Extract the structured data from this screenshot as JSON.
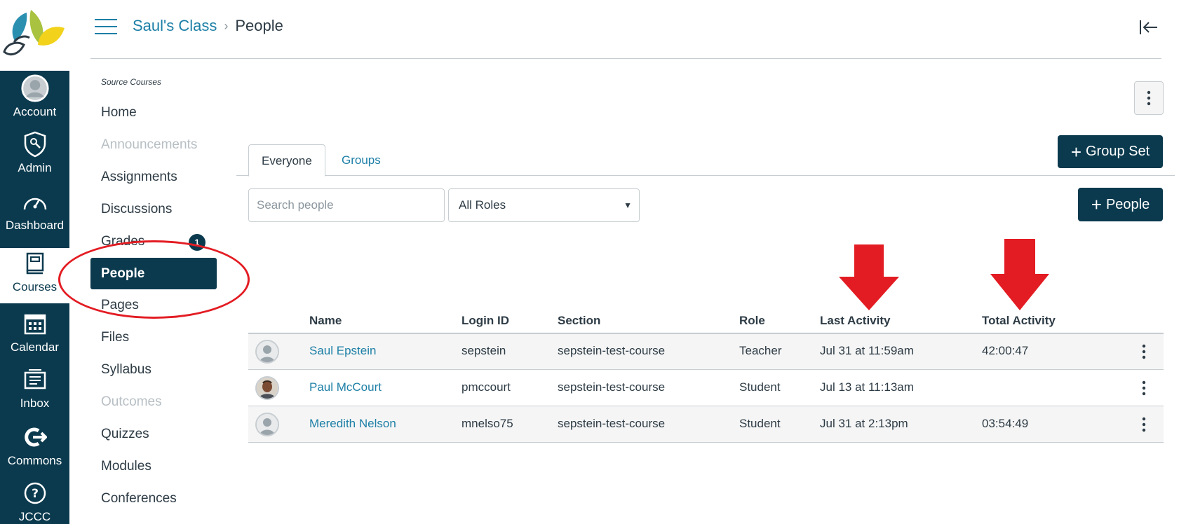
{
  "global_nav": {
    "items": [
      {
        "label": "Account",
        "icon": "account-icon"
      },
      {
        "label": "Admin",
        "icon": "admin-icon"
      },
      {
        "label": "Dashboard",
        "icon": "dashboard-icon"
      },
      {
        "label": "Courses",
        "icon": "courses-icon",
        "active": true
      },
      {
        "label": "Calendar",
        "icon": "calendar-icon"
      },
      {
        "label": "Inbox",
        "icon": "inbox-icon"
      },
      {
        "label": "Commons",
        "icon": "commons-icon"
      },
      {
        "label": "JCCC",
        "icon": "help-icon"
      }
    ]
  },
  "header": {
    "course": "Saul's Class",
    "separator": "›",
    "current": "People"
  },
  "course_nav": {
    "source_label": "Source Courses",
    "items": [
      {
        "label": "Home"
      },
      {
        "label": "Announcements",
        "disabled": true
      },
      {
        "label": "Assignments"
      },
      {
        "label": "Discussions"
      },
      {
        "label": "Grades",
        "badge": "1"
      },
      {
        "label": "People",
        "active": true
      },
      {
        "label": "Pages"
      },
      {
        "label": "Files"
      },
      {
        "label": "Syllabus"
      },
      {
        "label": "Outcomes",
        "disabled": true
      },
      {
        "label": "Quizzes"
      },
      {
        "label": "Modules"
      },
      {
        "label": "Conferences"
      }
    ]
  },
  "tabs": {
    "everyone": "Everyone",
    "groups": "Groups"
  },
  "buttons": {
    "group_set": "Group Set",
    "people": "People"
  },
  "search": {
    "placeholder": "Search people",
    "value": ""
  },
  "roles_select": {
    "selected": "All Roles"
  },
  "table": {
    "headers": {
      "name": "Name",
      "login": "Login ID",
      "section": "Section",
      "role": "Role",
      "last": "Last Activity",
      "total": "Total Activity"
    },
    "rows": [
      {
        "name": "Saul Epstein",
        "login": "sepstein",
        "section": "sepstein-test-course",
        "role": "Teacher",
        "last": "Jul 31 at 11:59am",
        "total": "42:00:47",
        "avatar": "default"
      },
      {
        "name": "Paul McCourt",
        "login": "pmccourt",
        "section": "sepstein-test-course",
        "role": "Student",
        "last": "Jul 13 at 11:13am",
        "total": "",
        "avatar": "photo"
      },
      {
        "name": "Meredith Nelson",
        "login": "mnelso75",
        "section": "sepstein-test-course",
        "role": "Student",
        "last": "Jul 31 at 2:13pm",
        "total": "03:54:49",
        "avatar": "default"
      }
    ]
  },
  "colors": {
    "brand_dark": "#0b3a4e",
    "link": "#1d7fa6",
    "annotation_red": "#e31c23"
  }
}
